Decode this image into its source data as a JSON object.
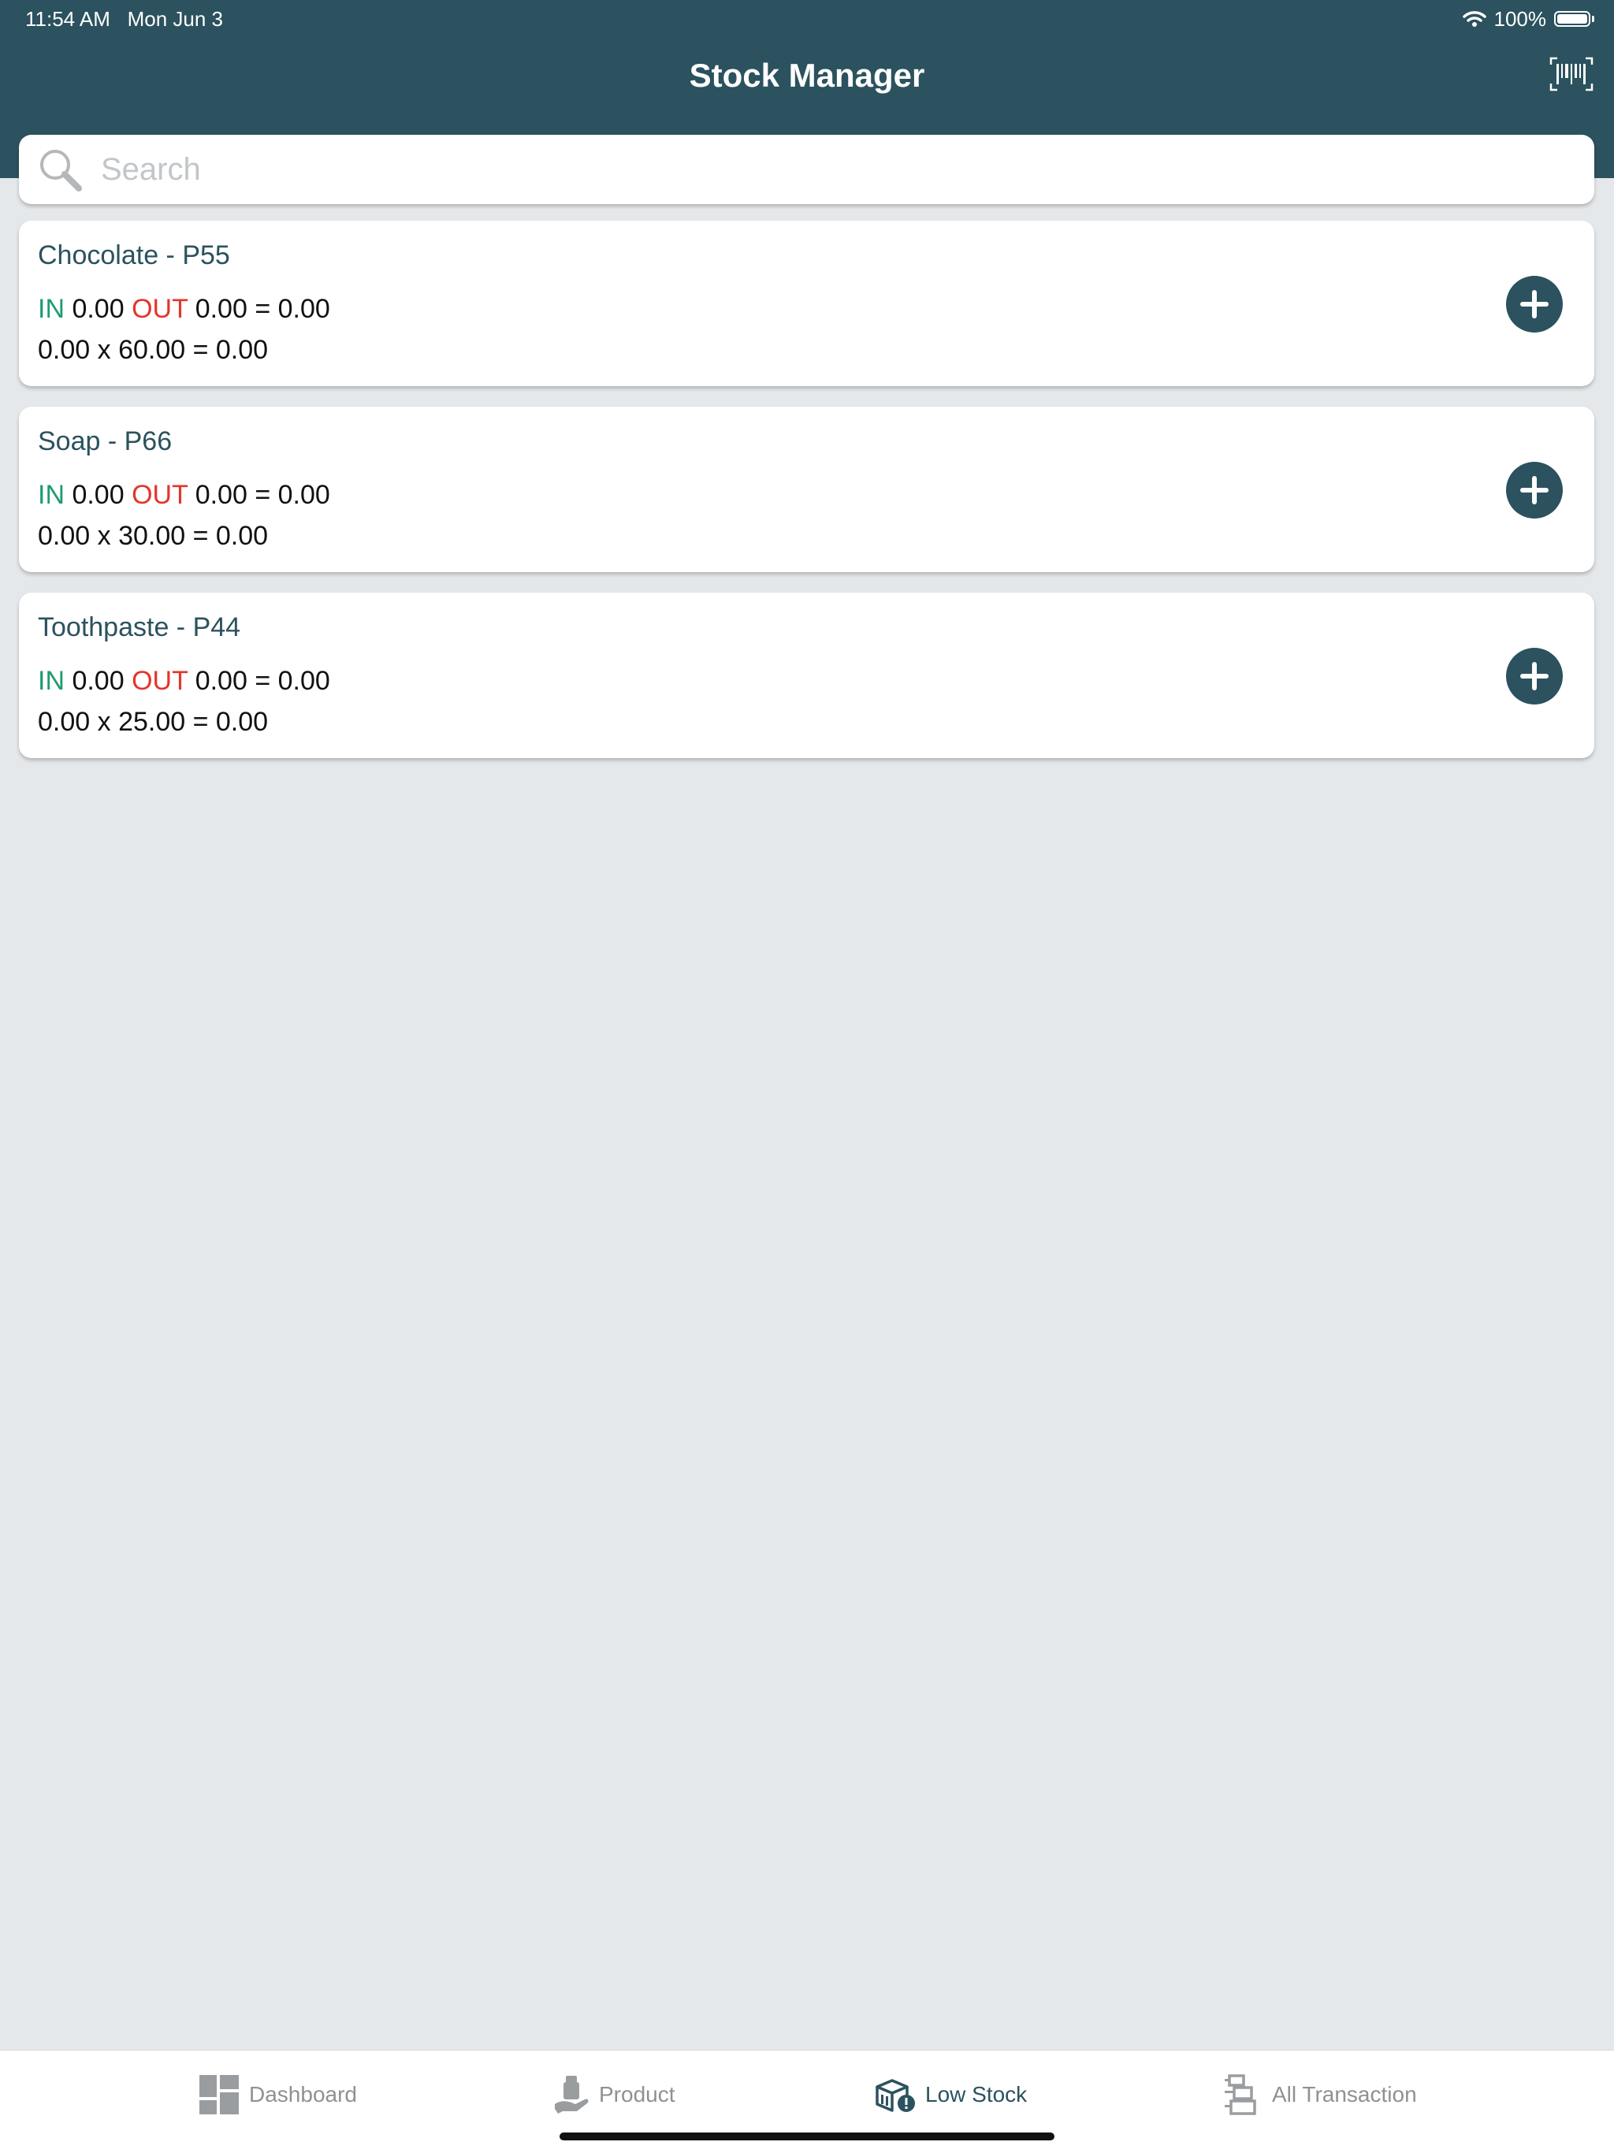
{
  "status_bar": {
    "time": "11:54 AM",
    "date": "Mon Jun 3",
    "battery": "100%"
  },
  "header": {
    "title": "Stock Manager"
  },
  "search": {
    "placeholder": "Search",
    "value": ""
  },
  "products": [
    {
      "title": "Chocolate - P55",
      "in_label": "IN",
      "in_value": "0.00",
      "out_label": "OUT",
      "out_value": "0.00",
      "equals": "= 0.00",
      "calc": "0.00 x 60.00 = 0.00"
    },
    {
      "title": "Soap - P66",
      "in_label": "IN",
      "in_value": "0.00",
      "out_label": "OUT",
      "out_value": "0.00",
      "equals": "= 0.00",
      "calc": "0.00 x 30.00 = 0.00"
    },
    {
      "title": "Toothpaste - P44",
      "in_label": "IN",
      "in_value": "0.00",
      "out_label": "OUT",
      "out_value": "0.00",
      "equals": "= 0.00",
      "calc": "0.00 x 25.00 = 0.00"
    }
  ],
  "tabs": [
    {
      "label": "Dashboard",
      "icon": "dashboard-icon",
      "active": false
    },
    {
      "label": "Product",
      "icon": "product-icon",
      "active": false
    },
    {
      "label": "Low Stock",
      "icon": "low-stock-icon",
      "active": true
    },
    {
      "label": "All Transaction",
      "icon": "transaction-icon",
      "active": false
    }
  ],
  "colors": {
    "header_bg": "#2b525e",
    "background": "#e4e8ea",
    "in": "#1f9c6f",
    "out": "#e4342c",
    "tab_inactive": "#8e9194"
  }
}
